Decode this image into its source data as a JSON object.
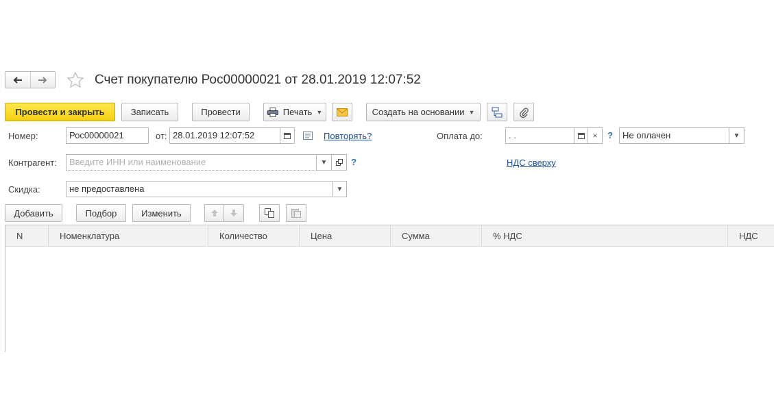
{
  "window": {
    "title": "Счет покупателю Рос00000021 от 28.01.2019 12:07:52",
    "back_icon": "arrow-left-icon",
    "forward_icon": "arrow-right-icon",
    "favorite_icon": "star-icon"
  },
  "toolbar": {
    "post_and_close": "Провести и закрыть",
    "save": "Записать",
    "post": "Провести",
    "print": "Печать",
    "create_based_on": "Создать на основании"
  },
  "form": {
    "number_label": "Номер:",
    "number_value": "Рос00000021",
    "date_label": "от:",
    "date_value": "28.01.2019 12:07:52",
    "repeat_link": "Повторять?",
    "payment_until_label": "Оплата до:",
    "payment_until_value": " .  .",
    "payment_status": "Не оплачен",
    "counterparty_label": "Контрагент:",
    "counterparty_placeholder": "Введите ИНН или наименование",
    "vat_link": "НДС сверху",
    "discount_label": "Скидка:",
    "discount_value": "не предоставлена",
    "help_mark": "?"
  },
  "table_toolbar": {
    "add": "Добавить",
    "pick": "Подбор",
    "change": "Изменить"
  },
  "table": {
    "columns": [
      "N",
      "Номенклатура",
      "Количество",
      "Цена",
      "Сумма",
      "% НДС",
      "НДС"
    ]
  },
  "colors": {
    "primary_button": "#f5cf12",
    "link": "#1b4f9c",
    "help": "#2a6fc9",
    "header_bg": "#f2f2f2"
  }
}
